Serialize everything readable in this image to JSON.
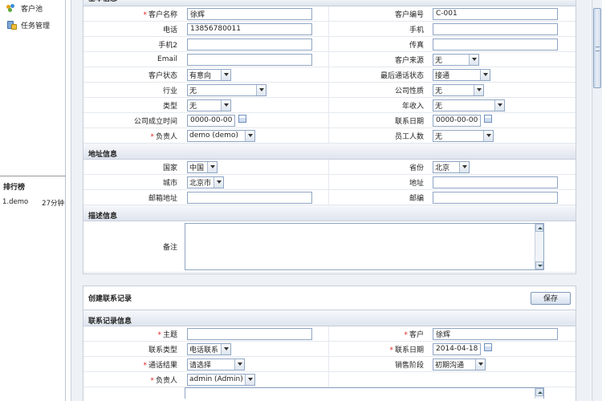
{
  "sidebar": {
    "items": [
      {
        "label": "客户池",
        "icon": "customer-pool-icon"
      },
      {
        "label": "任务管理",
        "icon": "task-management-icon"
      }
    ],
    "ranking": {
      "title": "排行榜",
      "rows": [
        {
          "name": "1.demo",
          "value": "27分钟"
        }
      ]
    }
  },
  "basic": {
    "title": "基本信息",
    "customer_name_label": "客户名称",
    "customer_name_value": "徐辉",
    "customer_code_label": "客户编号",
    "customer_code_value": "C-001",
    "phone_label": "电话",
    "phone_value": "13856780011",
    "mobile_label": "手机",
    "mobile_value": "",
    "mobile2_label": "手机2",
    "mobile2_value": "",
    "fax_label": "传真",
    "fax_value": "",
    "email_label": "Email",
    "email_value": "",
    "source_label": "客户来源",
    "source_value": "无",
    "status_label": "客户状态",
    "status_value": "有意向",
    "last_call_label": "最后通话状态",
    "last_call_value": "接通",
    "industry_label": "行业",
    "industry_value": "无",
    "company_nature_label": "公司性质",
    "company_nature_value": "无",
    "type_label": "类型",
    "type_value": "无",
    "income_label": "年收入",
    "income_value": "无",
    "founded_label": "公司成立时间",
    "founded_value": "0000-00-00",
    "contact_date_label": "联系日期",
    "contact_date_value": "0000-00-00",
    "owner_label": "负责人",
    "owner_value": "demo (demo)",
    "staff_label": "员工人数",
    "staff_value": "无"
  },
  "address": {
    "title": "地址信息",
    "country_label": "国家",
    "country_value": "中国",
    "province_label": "省份",
    "province_value": "北京",
    "city_label": "城市",
    "city_value": "北京市",
    "addr_label": "地址",
    "addr_value": "",
    "mail_addr_label": "邮箱地址",
    "mail_addr_value": "",
    "zip_label": "邮编",
    "zip_value": ""
  },
  "desc": {
    "title": "描述信息",
    "note_label": "备注"
  },
  "contact": {
    "panel_title": "创建联系记录",
    "save_label": "保存",
    "section_title": "联系记录信息",
    "subject_label": "主题",
    "subject_value": "",
    "customer_label": "客户",
    "customer_value": "徐辉",
    "type_label": "联系类型",
    "type_value": "电话联系",
    "date_label": "联系日期",
    "date_value": "2014-04-18",
    "result_label": "通话结果",
    "result_value": "请选择",
    "stage_label": "销售阶段",
    "stage_value": "初期沟通",
    "owner_label": "负责人",
    "owner_value": "admin (Admin)"
  },
  "colors": {
    "required": "#dd2222",
    "input_border": "#8fa5c4",
    "section_bg": "#dfe5ee"
  }
}
